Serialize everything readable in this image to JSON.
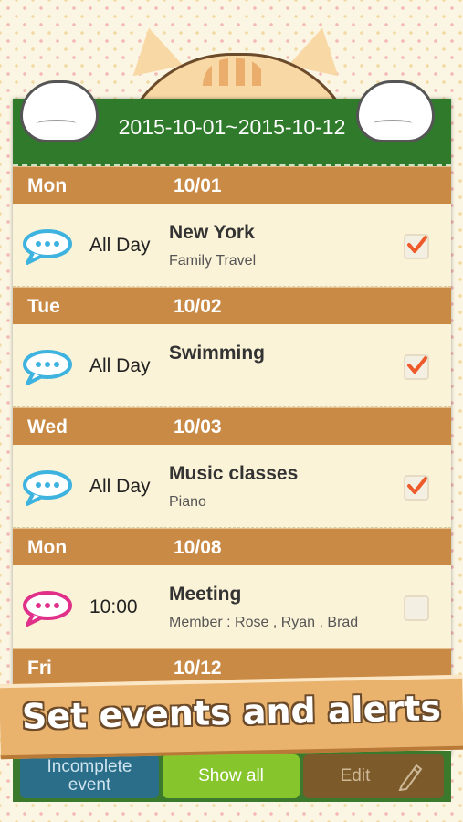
{
  "header": {
    "date_range": "2015-10-01~2015-10-12"
  },
  "days": [
    {
      "day": "Mon",
      "date": "10/01",
      "events": [
        {
          "time": "All Day",
          "title": "New York",
          "subtitle": "Family Travel",
          "checked": true,
          "bubble_color": "#3fb3df"
        }
      ]
    },
    {
      "day": "Tue",
      "date": "10/02",
      "events": [
        {
          "time": "All Day",
          "title": "Swimming",
          "subtitle": "",
          "checked": true,
          "bubble_color": "#3fb3df"
        }
      ]
    },
    {
      "day": "Wed",
      "date": "10/03",
      "events": [
        {
          "time": "All Day",
          "title": "Music classes",
          "subtitle": "Piano",
          "checked": true,
          "bubble_color": "#3fb3df"
        }
      ]
    },
    {
      "day": "Mon",
      "date": "10/08",
      "events": [
        {
          "time": "10:00",
          "title": "Meeting",
          "subtitle": "Member : Rose , Ryan , Brad",
          "checked": false,
          "bubble_color": "#e0308a"
        }
      ]
    },
    {
      "day": "Fri",
      "date": "10/12",
      "events": []
    }
  ],
  "banner": {
    "text": "Set events and alerts"
  },
  "bottom": {
    "incomplete_label_1": "Incomplete",
    "incomplete_label_2": "event",
    "show_all_label": "Show all",
    "edit_label": "Edit"
  },
  "icons": {
    "bubble": "speech-bubble-icon",
    "check": "checkmark-icon",
    "pencil": "pencil-icon"
  }
}
